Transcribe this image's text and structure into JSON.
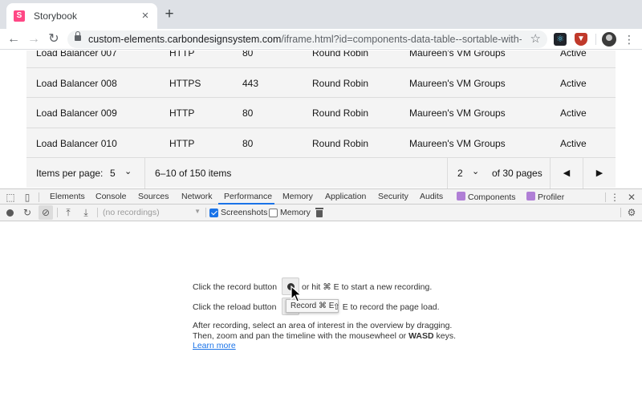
{
  "browser": {
    "tab_title": "Storybook",
    "tab_favicon_letter": "S",
    "url_host": "custom-elements.carbondesignsystem.com",
    "url_path": "/iframe.html?id=components-data-table--sortable-with-p..."
  },
  "table": {
    "rows": [
      [
        "Load Balancer 007",
        "HTTP",
        "80",
        "Round Robin",
        "Maureen's VM Groups",
        "Active"
      ],
      [
        "Load Balancer 008",
        "HTTPS",
        "443",
        "Round Robin",
        "Maureen's VM Groups",
        "Active"
      ],
      [
        "Load Balancer 009",
        "HTTP",
        "80",
        "Round Robin",
        "Maureen's VM Groups",
        "Active"
      ],
      [
        "Load Balancer 010",
        "HTTP",
        "80",
        "Round Robin",
        "Maureen's VM Groups",
        "Active"
      ]
    ]
  },
  "pagination": {
    "items_per_page_label": "Items per page:",
    "page_size": "5",
    "items_range": "6–10 of 150 items",
    "current_page": "2",
    "of_pages": "of 30 pages"
  },
  "devtools": {
    "tabs": [
      "Elements",
      "Console",
      "Sources",
      "Network",
      "Performance",
      "Memory",
      "Application",
      "Security",
      "Audits",
      "Components",
      "Profiler"
    ],
    "active_tab": "Performance",
    "recordings_placeholder": "(no recordings)",
    "screenshots_label": "Screenshots",
    "screenshots_checked": true,
    "memory_label": "Memory",
    "memory_checked": false
  },
  "landing": {
    "record_prefix": "Click the record button",
    "record_suffix": "or hit ⌘ E to start a new recording.",
    "reload_prefix": "Click the reload button",
    "reload_suffix": "⇧ E to record the page load.",
    "tooltip": "Record ⌘ E",
    "after_line1": "After recording, select an area of interest in the overview by dragging.",
    "after_line2_a": "Then, zoom and pan the timeline with the mousewheel or",
    "after_line2_b": "WASD",
    "after_line2_c": "keys.",
    "learn_more": "Learn more"
  }
}
